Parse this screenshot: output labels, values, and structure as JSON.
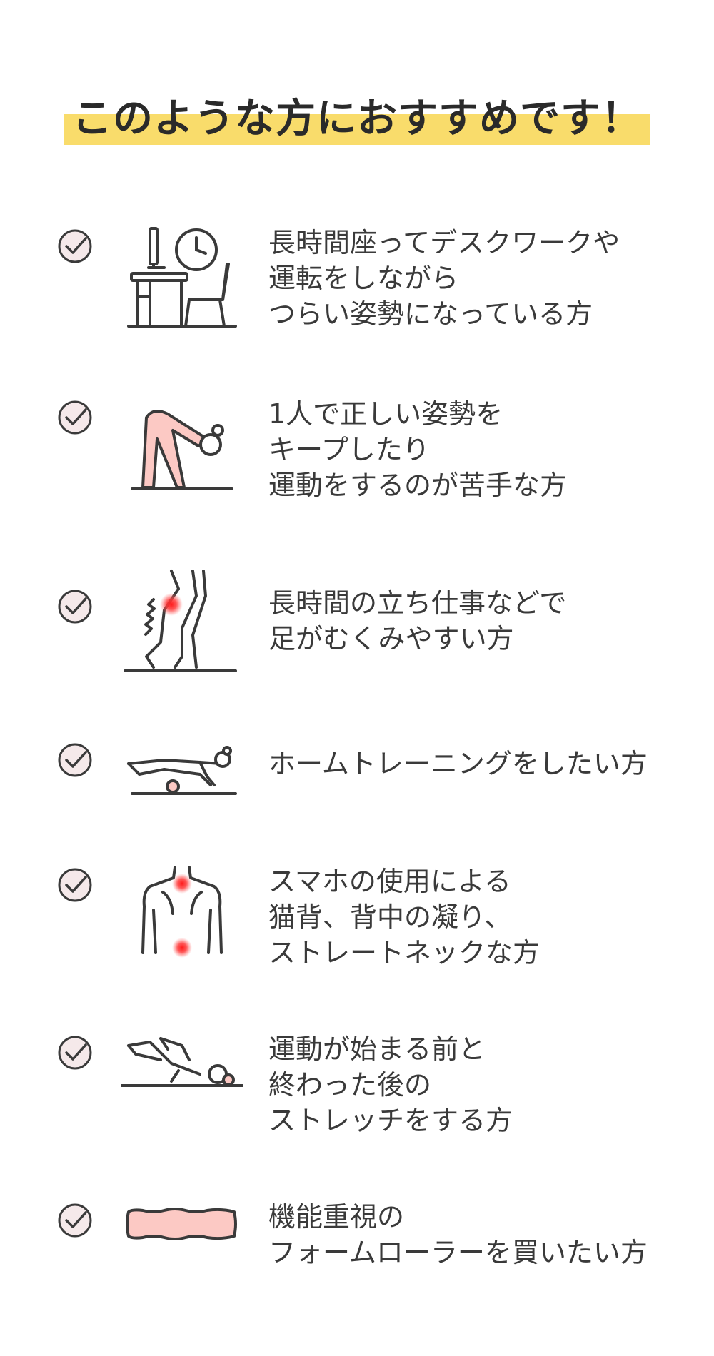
{
  "title": "このような方におすすめです！",
  "colors": {
    "highlight": "#f9dc6b",
    "pink": "#fcc9c4",
    "red": "#ff2a2a",
    "line": "#3a3a3a",
    "check_fill": "#f5e9ea"
  },
  "items": [
    {
      "icon": "desk-clock-icon",
      "lines": [
        "長時間座ってデスクワークや",
        "運転をしながら",
        "つらい姿勢になっている方"
      ]
    },
    {
      "icon": "stretching-woman-icon",
      "lines": [
        "1人で正しい姿勢を",
        "キープしたり",
        "運動をするのが苦手な方"
      ]
    },
    {
      "icon": "swollen-legs-icon",
      "lines": [
        "長時間の立ち仕事などで",
        "足がむくみやすい方"
      ]
    },
    {
      "icon": "home-training-icon",
      "lines": [
        "ホームトレーニングをしたい方"
      ]
    },
    {
      "icon": "back-pain-icon",
      "lines": [
        "スマホの使用による",
        "猫背、背中の凝り、",
        "ストレートネックな方"
      ]
    },
    {
      "icon": "lying-stretch-icon",
      "lines": [
        "運動が始まる前と",
        "終わった後の",
        "ストレッチをする方"
      ]
    },
    {
      "icon": "foam-roller-icon",
      "lines": [
        "機能重視の",
        "フォームローラーを買いたい方"
      ]
    }
  ]
}
